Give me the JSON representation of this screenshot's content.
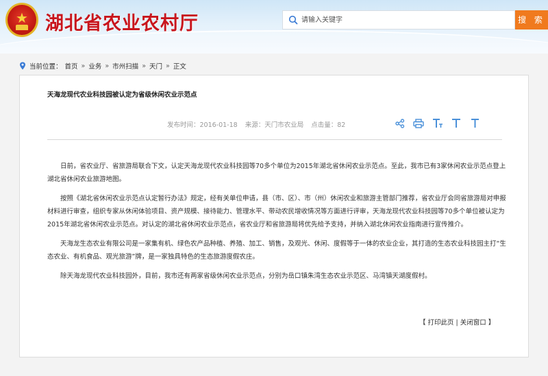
{
  "header": {
    "site_title": "湖北省农业农村厅",
    "search_placeholder": "请输入关键字",
    "search_button": "搜 索",
    "emblem_icon": "national-emblem",
    "accent_color": "#c8161d",
    "button_color": "#f07a1e"
  },
  "breadcrumb": {
    "label": "当前位置：",
    "items": [
      "首页",
      "业务",
      "市州扫描",
      "天门",
      "正文"
    ],
    "separator": "»"
  },
  "article": {
    "title": "天海龙现代农业科技园被认定为省级休闲农业示范点",
    "publish_time": "发布时间：2016-01-18",
    "source": "来源：天门市农业局",
    "clicks": "点击量：82",
    "tools": [
      "share-icon",
      "print-icon",
      "font-large-icon",
      "font-medium-icon",
      "font-small-icon"
    ],
    "paragraphs": [
      "日前，省农业厅、省旅游局联合下文，认定天海龙现代农业科技园等70多个单位为2015年湖北省休闲农业示范点。至此，我市已有3家休闲农业示范点登上湖北省休闲农业旅游地图。",
      "按照《湖北省休闲农业示范点认定暂行办法》规定，经有关单位申请，县（市、区）、市（州）休闲农业和旅游主管部门推荐，省农业厅会同省旅游局对申报材料进行审查，组织专家从休闲体验项目、资产规模、接待能力、管理水平、带动农民增收情况等方面进行评审，天海龙现代农业科技园等70多个单位被认定为2015年湖北省休闲农业示范点。对认定的湖北省休闲农业示范点，省农业厅和省旅游局将优先给予支持，并纳入湖北休闲农业指南进行宣传推介。",
      "天海龙生态农业有限公司是一家集有机、绿色农产品种植、养殖、加工、销售，及观光、休闲、度假等于一体的农业企业，其打造的生态农业科技园主打“生态农业、有机食品、观光旅游”牌，是一家独具特色的生态旅游度假农庄。",
      "除天海龙现代农业科技园外，目前，我市还有两家省级休闲农业示范点，分别为岳口镇朱湾生态农业示范区、马湾镇天湖度假村。"
    ],
    "print_links": "【 打印此页 | 关闭窗口 】"
  }
}
